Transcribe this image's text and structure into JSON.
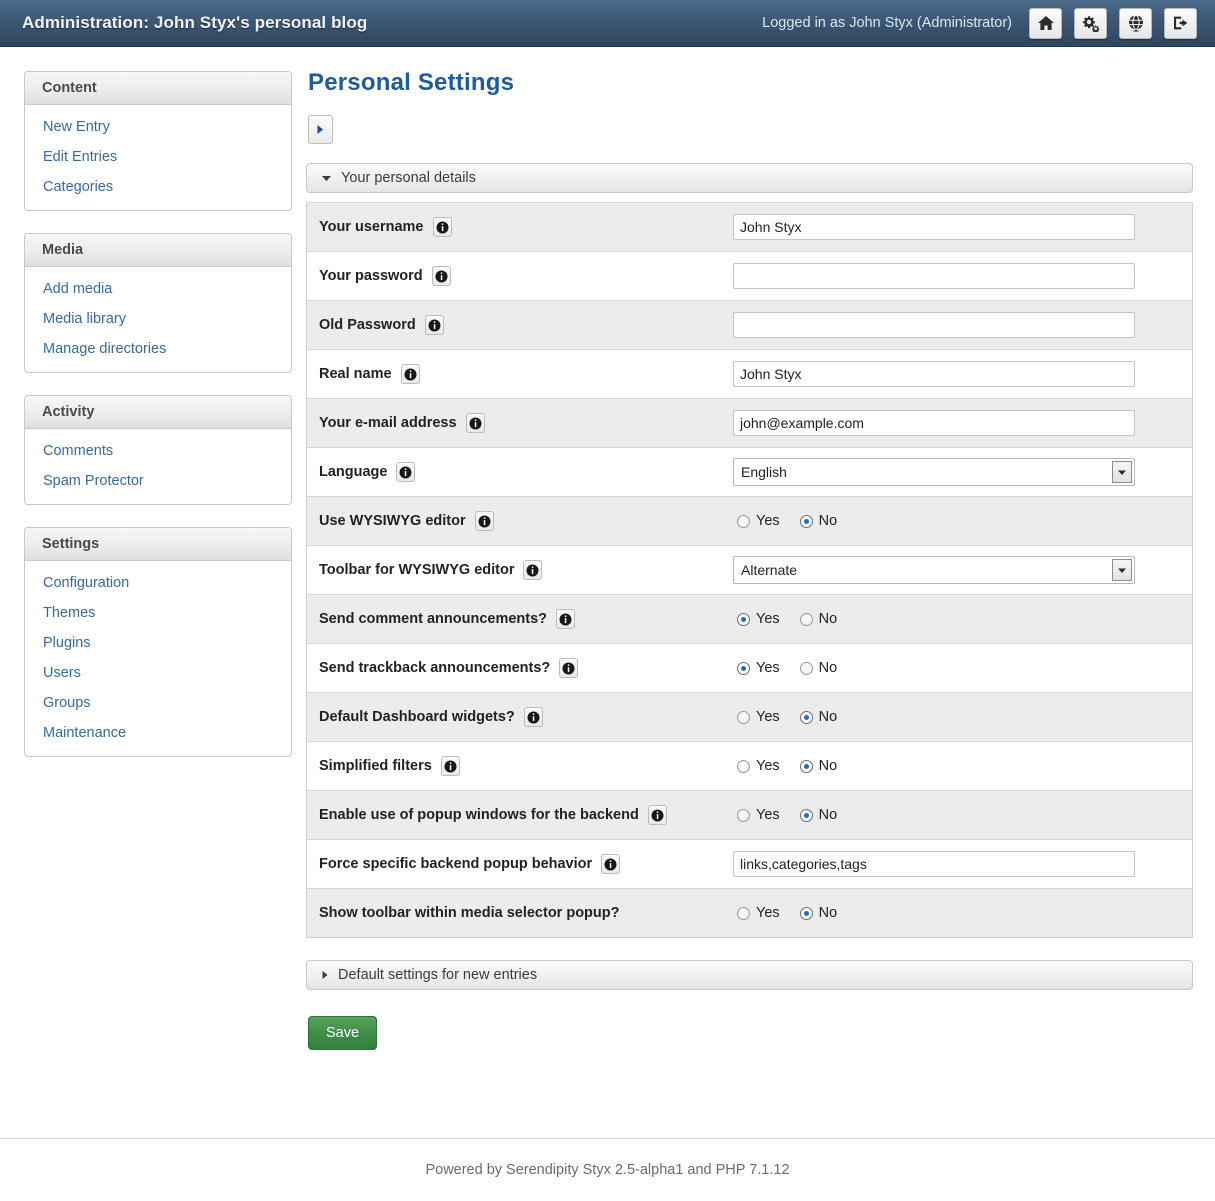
{
  "topbar": {
    "title": "Administration: John Styx's personal blog",
    "logged_in": "Logged in as John Styx (Administrator)",
    "buttons": [
      {
        "name": "home-icon",
        "label": "Home"
      },
      {
        "name": "gears-icon",
        "label": "Configuration"
      },
      {
        "name": "globe-icon",
        "label": "View blog"
      },
      {
        "name": "logout-icon",
        "label": "Logout"
      }
    ]
  },
  "sidebar": {
    "blocks": [
      {
        "title": "Content",
        "items": [
          {
            "label": "New Entry"
          },
          {
            "label": "Edit Entries"
          },
          {
            "label": "Categories"
          }
        ]
      },
      {
        "title": "Media",
        "items": [
          {
            "label": "Add media"
          },
          {
            "label": "Media library"
          },
          {
            "label": "Manage directories"
          }
        ]
      },
      {
        "title": "Activity",
        "items": [
          {
            "label": "Comments"
          },
          {
            "label": "Spam Protector"
          }
        ]
      },
      {
        "title": "Settings",
        "items": [
          {
            "label": "Configuration"
          },
          {
            "label": "Themes"
          },
          {
            "label": "Plugins"
          },
          {
            "label": "Users"
          },
          {
            "label": "Groups"
          },
          {
            "label": "Maintenance"
          }
        ]
      }
    ]
  },
  "main": {
    "page_title": "Personal Settings",
    "expand_all_button": "",
    "panel_open": {
      "title": "Your personal details"
    },
    "panel_closed": {
      "title": "Default settings for new entries"
    },
    "save_label": "Save",
    "yes_label": "Yes",
    "no_label": "No",
    "rows": [
      {
        "label": "Your username",
        "info": true,
        "type": "text",
        "value": "John Styx"
      },
      {
        "label": "Your password",
        "info": true,
        "type": "password",
        "value": ""
      },
      {
        "label": "Old Password",
        "info": true,
        "type": "password",
        "value": ""
      },
      {
        "label": "Real name",
        "info": true,
        "type": "text",
        "value": "John Styx"
      },
      {
        "label": "Your e-mail address",
        "info": true,
        "type": "text",
        "value": "john@example.com"
      },
      {
        "label": "Language",
        "info": true,
        "type": "select",
        "value": "English"
      },
      {
        "label": "Use WYSIWYG editor",
        "info": true,
        "type": "radio",
        "value": "No"
      },
      {
        "label": "Toolbar for WYSIWYG editor",
        "info": true,
        "type": "select",
        "value": "Alternate"
      },
      {
        "label": "Send comment announcements?",
        "info": true,
        "type": "radio",
        "value": "Yes"
      },
      {
        "label": "Send trackback announcements?",
        "info": true,
        "type": "radio",
        "value": "Yes"
      },
      {
        "label": "Default Dashboard widgets?",
        "info": true,
        "type": "radio",
        "value": "No"
      },
      {
        "label": "Simplified filters",
        "info": true,
        "type": "radio",
        "value": "No"
      },
      {
        "label": "Enable use of popup windows for the backend",
        "info": true,
        "type": "radio",
        "value": "No"
      },
      {
        "label": "Force specific backend popup behavior",
        "info": true,
        "type": "text",
        "value": "links,categories,tags"
      },
      {
        "label": "Show toolbar within media selector popup?",
        "info": false,
        "type": "radio",
        "value": "No"
      }
    ]
  },
  "footer": {
    "text": "Powered by Serendipity Styx 2.5-alpha1 and PHP 7.1.12"
  },
  "colors": {
    "topbar": "#3d5875",
    "title_blue": "#1d5b9e",
    "link_blue": "#3a6a99",
    "save_green": "#3e8e48",
    "radio_dot": "#1b6fc4"
  }
}
